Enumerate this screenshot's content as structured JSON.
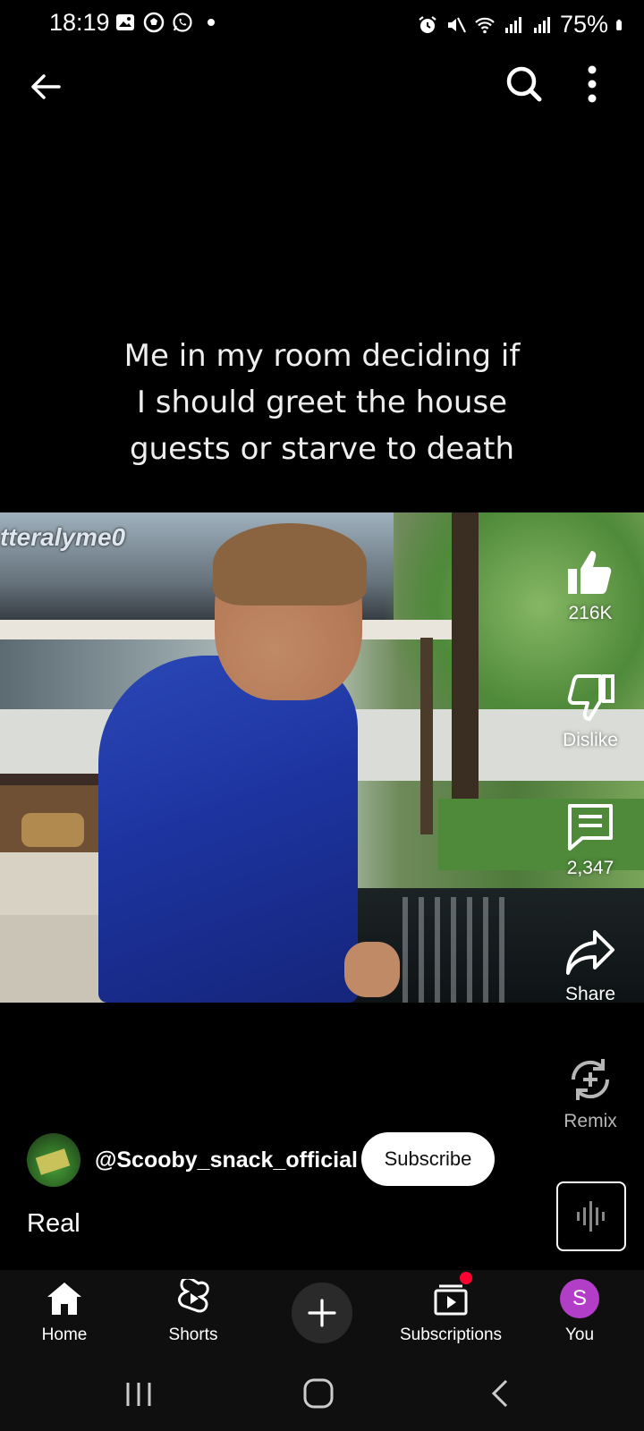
{
  "status_bar": {
    "time": "18:19",
    "battery": "75%",
    "left_icons": [
      "gallery-icon",
      "soccer-icon",
      "whatsapp-icon",
      "dot-icon"
    ],
    "right_icons": [
      "alarm-icon",
      "mute-icon",
      "wifi-icon",
      "signal-icon",
      "signal-icon",
      "battery-icon"
    ]
  },
  "top_bar": {
    "back_icon": "back-arrow-icon",
    "search_icon": "search-icon",
    "more_icon": "more-vert-icon"
  },
  "caption": {
    "line1": "Me in my room deciding if",
    "line2": "I should greet the house",
    "line3": "guests or starve to death"
  },
  "video": {
    "watermark": "tteralyme0"
  },
  "actions": {
    "like_count": "216K",
    "dislike_label": "Dislike",
    "comments_count": "2,347",
    "share_label": "Share",
    "remix_label": "Remix"
  },
  "channel": {
    "name": "@Scooby_snack_official",
    "subscribe_label": "Subscribe"
  },
  "video_title": "Real",
  "bottom_nav": {
    "items": [
      {
        "label": "Home",
        "icon": "home-icon",
        "active": true
      },
      {
        "label": "Shorts",
        "icon": "shorts-icon"
      },
      {
        "label": "",
        "icon": "plus-icon"
      },
      {
        "label": "Subscriptions",
        "icon": "subscriptions-icon",
        "badge": true
      },
      {
        "label": "You",
        "icon": "avatar",
        "initial": "S"
      }
    ]
  },
  "colors": {
    "background": "#000000",
    "nav_background": "#0f0f0f",
    "subscribe_bg": "#ffffff",
    "notification": "#ff0033",
    "you_avatar": "#b23ec7"
  }
}
